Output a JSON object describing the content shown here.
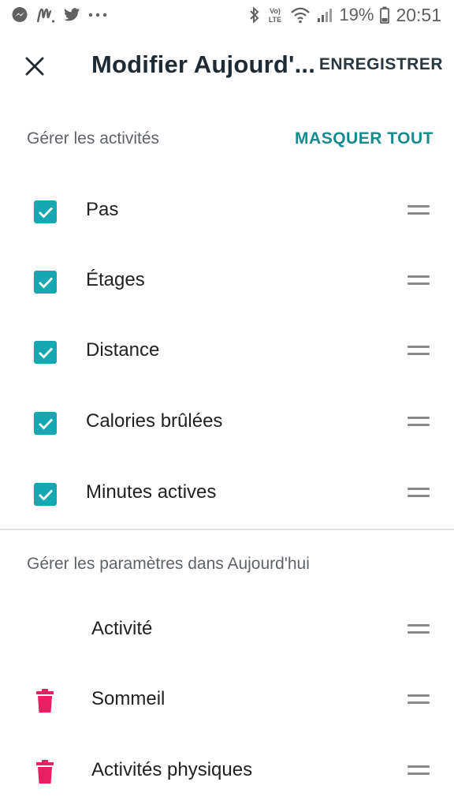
{
  "status_bar": {
    "battery_percent": "19%",
    "time": "20:51",
    "icons": [
      "messenger-icon",
      "mail-m-icon",
      "twitter-icon",
      "more-dots-icon",
      "bluetooth-icon",
      "volte-icon",
      "wifi-icon",
      "signal-icon",
      "battery-icon"
    ]
  },
  "header": {
    "title": "Modifier Aujourd'...",
    "save_label": "ENREGISTRER",
    "close_icon": "close-icon"
  },
  "activities_section": {
    "heading": "Gérer les activités",
    "hide_all_label": "MASQUER TOUT",
    "items": [
      {
        "label": "Pas",
        "checked": true
      },
      {
        "label": "Étages",
        "checked": true
      },
      {
        "label": "Distance",
        "checked": true
      },
      {
        "label": "Calories brûlées",
        "checked": true
      },
      {
        "label": "Minutes actives",
        "checked": true
      }
    ]
  },
  "settings_section": {
    "heading": "Gérer les paramètres dans Aujourd'hui",
    "items": [
      {
        "label": "Activité",
        "deletable": false
      },
      {
        "label": "Sommeil",
        "deletable": true
      },
      {
        "label": "Activités physiques",
        "deletable": true
      }
    ]
  },
  "colors": {
    "accent_teal": "#17a7b0",
    "link_teal": "#168b8f",
    "delete_pink": "#e91e63",
    "drag_handle": "#8a8a8a"
  }
}
